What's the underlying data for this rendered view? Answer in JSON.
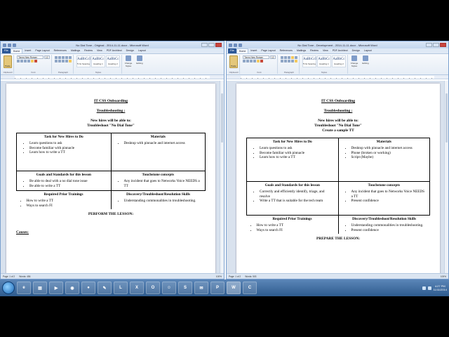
{
  "colors": {
    "file_tab": "#2b5797",
    "ribbon": "#e6edf6",
    "taskbar": "#2e5b8e",
    "doc_bg": "#d9e2ee"
  },
  "left": {
    "title": "No Dial Tone - Original - 2014-11-11.docx - Microsoft Word",
    "tabs": [
      "File",
      "Home",
      "Insert",
      "Page Layout",
      "References",
      "Mailings",
      "Review",
      "View",
      "PDF Architect",
      "Design",
      "Layout"
    ],
    "font_name": "Times New Roman",
    "font_size": "12",
    "paste_label": "Paste",
    "styles": [
      {
        "sample": "AaBbCcI",
        "name": "¶ No Spacing"
      },
      {
        "sample": "AaBbCc",
        "name": "Heading 1"
      },
      {
        "sample": "AaBbCc",
        "name": "Heading 2"
      }
    ],
    "change_styles": "Change Styles",
    "editing": "Editing",
    "group_labels": [
      "Clipboard",
      "Font",
      "Paragraph",
      "Styles"
    ],
    "status": {
      "page": "Page: 1 of 2",
      "words": "Words: 456",
      "zoom": "100%"
    },
    "doc": {
      "h1": "IT CSS Onboarding",
      "h2": "Troubleshooting :",
      "goal_line1": "New hires will be able to:",
      "goal_line2": "Troubleshoot \"No Dial Tone\"",
      "rows": [
        {
          "a_head": "Task for New Hires to Do",
          "a_items": [
            "Learn questions to ask",
            "Become familiar with pinnacle",
            "Learn how to write a TT"
          ],
          "b_head": "Materials",
          "b_items": [
            "Desktop with pinnacle and internet access"
          ]
        },
        {
          "a_head": "Goals and Standards for this lesson",
          "a_items": [
            "Be able to deal with a no dial tone issue",
            "Be able to write a TT"
          ],
          "b_head": "Touchstone concepts",
          "b_items": [
            "Any incident that goes to Networks Voice NEEDS a TT"
          ]
        },
        {
          "a_head": "Required Prior Trainings",
          "a_items": [
            "How to write a TT",
            "Ways to search FI"
          ],
          "b_head": "Discovery/Troubleshoot/Resolution Skills",
          "b_items": [
            "Understanding commonalities in troubleshooting."
          ]
        }
      ],
      "perform": "PERFORM THE LESSON:",
      "causes": "Causes:"
    }
  },
  "right": {
    "title": "No Dial Tone - Development - 2014-11-11.docx - Microsoft Word",
    "tabs": [
      "File",
      "Home",
      "Insert",
      "Page Layout",
      "References",
      "Mailings",
      "Review",
      "View",
      "PDF Architect",
      "Design",
      "Layout"
    ],
    "font_name": "Times New Roman",
    "font_size": "12",
    "paste_label": "Paste",
    "styles": [
      {
        "sample": "AaBbCcI",
        "name": "¶ No Spacing"
      },
      {
        "sample": "AaBbCc",
        "name": "Heading 1"
      },
      {
        "sample": "AaBbCc",
        "name": "Heading 2"
      }
    ],
    "change_styles": "Change Styles",
    "editing": "Editing",
    "group_labels": [
      "Clipboard",
      "Font",
      "Paragraph",
      "Styles"
    ],
    "status": {
      "page": "Page: 1 of 2",
      "words": "Words: 503",
      "zoom": "100%"
    },
    "doc": {
      "h1": "IT CSS Onboarding",
      "h2": "Troubleshooting :",
      "goal_line1": "New hires will be able to:",
      "goal_line2": "Troubleshoot \"No Dial Tone\"",
      "goal_line3": "Create a sample TT",
      "rows": [
        {
          "a_head": "Task for New Hires to Do",
          "a_items": [
            "Learn questions to ask",
            "Become familiar with pinnacle",
            "Learn how to write a TT"
          ],
          "b_head": "Materials",
          "b_items": [
            "Desktop with pinnacle and internet access",
            "Phone (broken or working)",
            "Script (Maybe)"
          ]
        },
        {
          "a_head": "Goals and Standards for this lesson",
          "a_items": [
            "Correctly and efficiently identify, triage, and resolve",
            "Write a TT that is suitable for the tech team"
          ],
          "b_head": "Touchstone concepts",
          "b_items": [
            "Any incident that goes to Networks Voice NEEDS a TT",
            "Present confidence"
          ]
        },
        {
          "a_head": "Required Prior Trainings",
          "a_items": [
            "How to write a TT",
            "Ways to search FI"
          ],
          "b_head": "Discovery/Troubleshoot/Resolution Skills",
          "b_items": [
            "Understanding commonalities in troubleshooting.",
            "Present confidence"
          ]
        }
      ],
      "perform": "PREPARE THE LESSON:"
    }
  },
  "taskbar": {
    "apps": [
      "IE",
      "Folder",
      "Media",
      "Chrome",
      "Firefox",
      "Notes",
      "Lync",
      "Excel",
      "Outlook",
      "People",
      "Skype",
      "Mail",
      "PowerPoint",
      "Word",
      "Camtasia"
    ],
    "clock_time": "4:27 PM",
    "clock_date": "11/11/2014"
  }
}
